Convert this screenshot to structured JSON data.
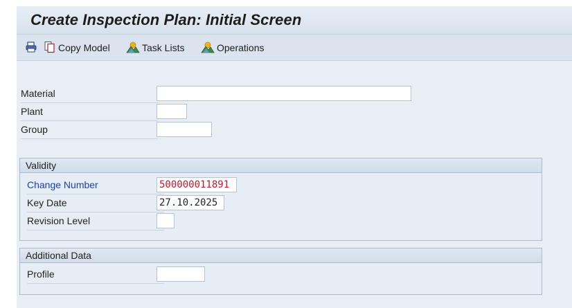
{
  "title": "Create Inspection Plan: Initial Screen",
  "toolbar": {
    "print_icon": "printer-icon",
    "copy_model": {
      "icon": "copy-document-icon",
      "label": "Copy Model"
    },
    "task_lists": {
      "icon": "mountain-sun-icon",
      "label": "Task Lists"
    },
    "operations": {
      "icon": "mountain-sun-icon",
      "label": "Operations"
    }
  },
  "fields": {
    "material": {
      "label": "Material",
      "value": ""
    },
    "plant": {
      "label": "Plant",
      "value": ""
    },
    "group": {
      "label": "Group",
      "value": ""
    }
  },
  "validity": {
    "title": "Validity",
    "change_number": {
      "label": "Change Number",
      "value": "500000011891"
    },
    "key_date": {
      "label": "Key Date",
      "value": "27.10.2025"
    },
    "revision_level": {
      "label": "Revision Level",
      "value": ""
    }
  },
  "additional_data": {
    "title": "Additional Data",
    "profile": {
      "label": "Profile",
      "value": ""
    }
  },
  "colors": {
    "link_label": "#1a3fb8",
    "change_number_value": "#c0182a",
    "background": "#e9eef4"
  }
}
